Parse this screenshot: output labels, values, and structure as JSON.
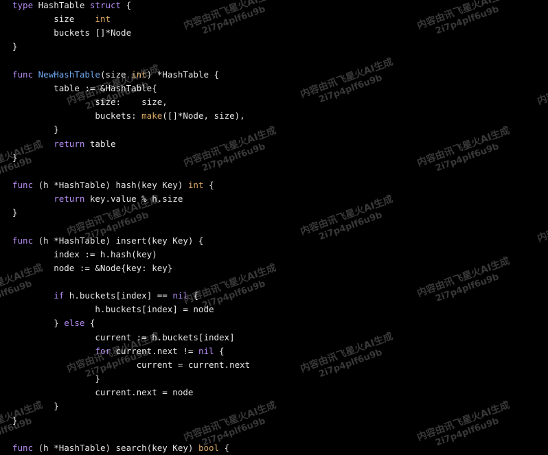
{
  "colors": {
    "background": "#000000",
    "text": "#e6e6e6",
    "keyword": "#b48cf2",
    "type": "#d9a864",
    "function": "#6fa8f0"
  },
  "watermark": {
    "line1": "内容由讯飞星火AI生成",
    "line2": "2i7p4plf6u9b"
  },
  "code": {
    "lines": [
      [
        {
          "t": "kw",
          "s": "type"
        },
        {
          "t": "plain",
          "s": " HashTable "
        },
        {
          "t": "kw",
          "s": "struct"
        },
        {
          "t": "plain",
          "s": " {"
        }
      ],
      [
        {
          "t": "plain",
          "s": "        size    "
        },
        {
          "t": "type",
          "s": "int"
        }
      ],
      [
        {
          "t": "plain",
          "s": "        buckets []*Node"
        }
      ],
      [
        {
          "t": "plain",
          "s": "}"
        }
      ],
      [],
      [
        {
          "t": "kw",
          "s": "func"
        },
        {
          "t": "plain",
          "s": " "
        },
        {
          "t": "fn",
          "s": "NewHashTable"
        },
        {
          "t": "plain",
          "s": "(size "
        },
        {
          "t": "type",
          "s": "int"
        },
        {
          "t": "plain",
          "s": ") *HashTable {"
        }
      ],
      [
        {
          "t": "plain",
          "s": "        table := &HashTable{"
        }
      ],
      [
        {
          "t": "plain",
          "s": "                size:    size,"
        }
      ],
      [
        {
          "t": "plain",
          "s": "                buckets: "
        },
        {
          "t": "type",
          "s": "make"
        },
        {
          "t": "plain",
          "s": "([]*Node, size),"
        }
      ],
      [
        {
          "t": "plain",
          "s": "        }"
        }
      ],
      [
        {
          "t": "plain",
          "s": "        "
        },
        {
          "t": "kw",
          "s": "return"
        },
        {
          "t": "plain",
          "s": " table"
        }
      ],
      [
        {
          "t": "plain",
          "s": "}"
        }
      ],
      [],
      [
        {
          "t": "kw",
          "s": "func"
        },
        {
          "t": "plain",
          "s": " (h *HashTable) hash(key Key) "
        },
        {
          "t": "type",
          "s": "int"
        },
        {
          "t": "plain",
          "s": " {"
        }
      ],
      [
        {
          "t": "plain",
          "s": "        "
        },
        {
          "t": "kw",
          "s": "return"
        },
        {
          "t": "plain",
          "s": " key.value % h.size"
        }
      ],
      [
        {
          "t": "plain",
          "s": "}"
        }
      ],
      [],
      [
        {
          "t": "kw",
          "s": "func"
        },
        {
          "t": "plain",
          "s": " (h *HashTable) insert(key Key) {"
        }
      ],
      [
        {
          "t": "plain",
          "s": "        index := h.hash(key)"
        }
      ],
      [
        {
          "t": "plain",
          "s": "        node := &Node{key: key}"
        }
      ],
      [],
      [
        {
          "t": "plain",
          "s": "        "
        },
        {
          "t": "kw",
          "s": "if"
        },
        {
          "t": "plain",
          "s": " h.buckets[index] == "
        },
        {
          "t": "kw",
          "s": "nil"
        },
        {
          "t": "plain",
          "s": " {"
        }
      ],
      [
        {
          "t": "plain",
          "s": "                h.buckets[index] = node"
        }
      ],
      [
        {
          "t": "plain",
          "s": "        } "
        },
        {
          "t": "kw",
          "s": "else"
        },
        {
          "t": "plain",
          "s": " {"
        }
      ],
      [
        {
          "t": "plain",
          "s": "                current := h.buckets[index]"
        }
      ],
      [
        {
          "t": "plain",
          "s": "                "
        },
        {
          "t": "kw",
          "s": "for"
        },
        {
          "t": "plain",
          "s": " current.next != "
        },
        {
          "t": "kw",
          "s": "nil"
        },
        {
          "t": "plain",
          "s": " {"
        }
      ],
      [
        {
          "t": "plain",
          "s": "                        current = current.next"
        }
      ],
      [
        {
          "t": "plain",
          "s": "                }"
        }
      ],
      [
        {
          "t": "plain",
          "s": "                current.next = node"
        }
      ],
      [
        {
          "t": "plain",
          "s": "        }"
        }
      ],
      [
        {
          "t": "plain",
          "s": "}"
        }
      ],
      [],
      [
        {
          "t": "kw",
          "s": "func"
        },
        {
          "t": "plain",
          "s": " (h *HashTable) search(key Key) "
        },
        {
          "t": "type",
          "s": "bool"
        },
        {
          "t": "plain",
          "s": " {"
        }
      ]
    ]
  }
}
